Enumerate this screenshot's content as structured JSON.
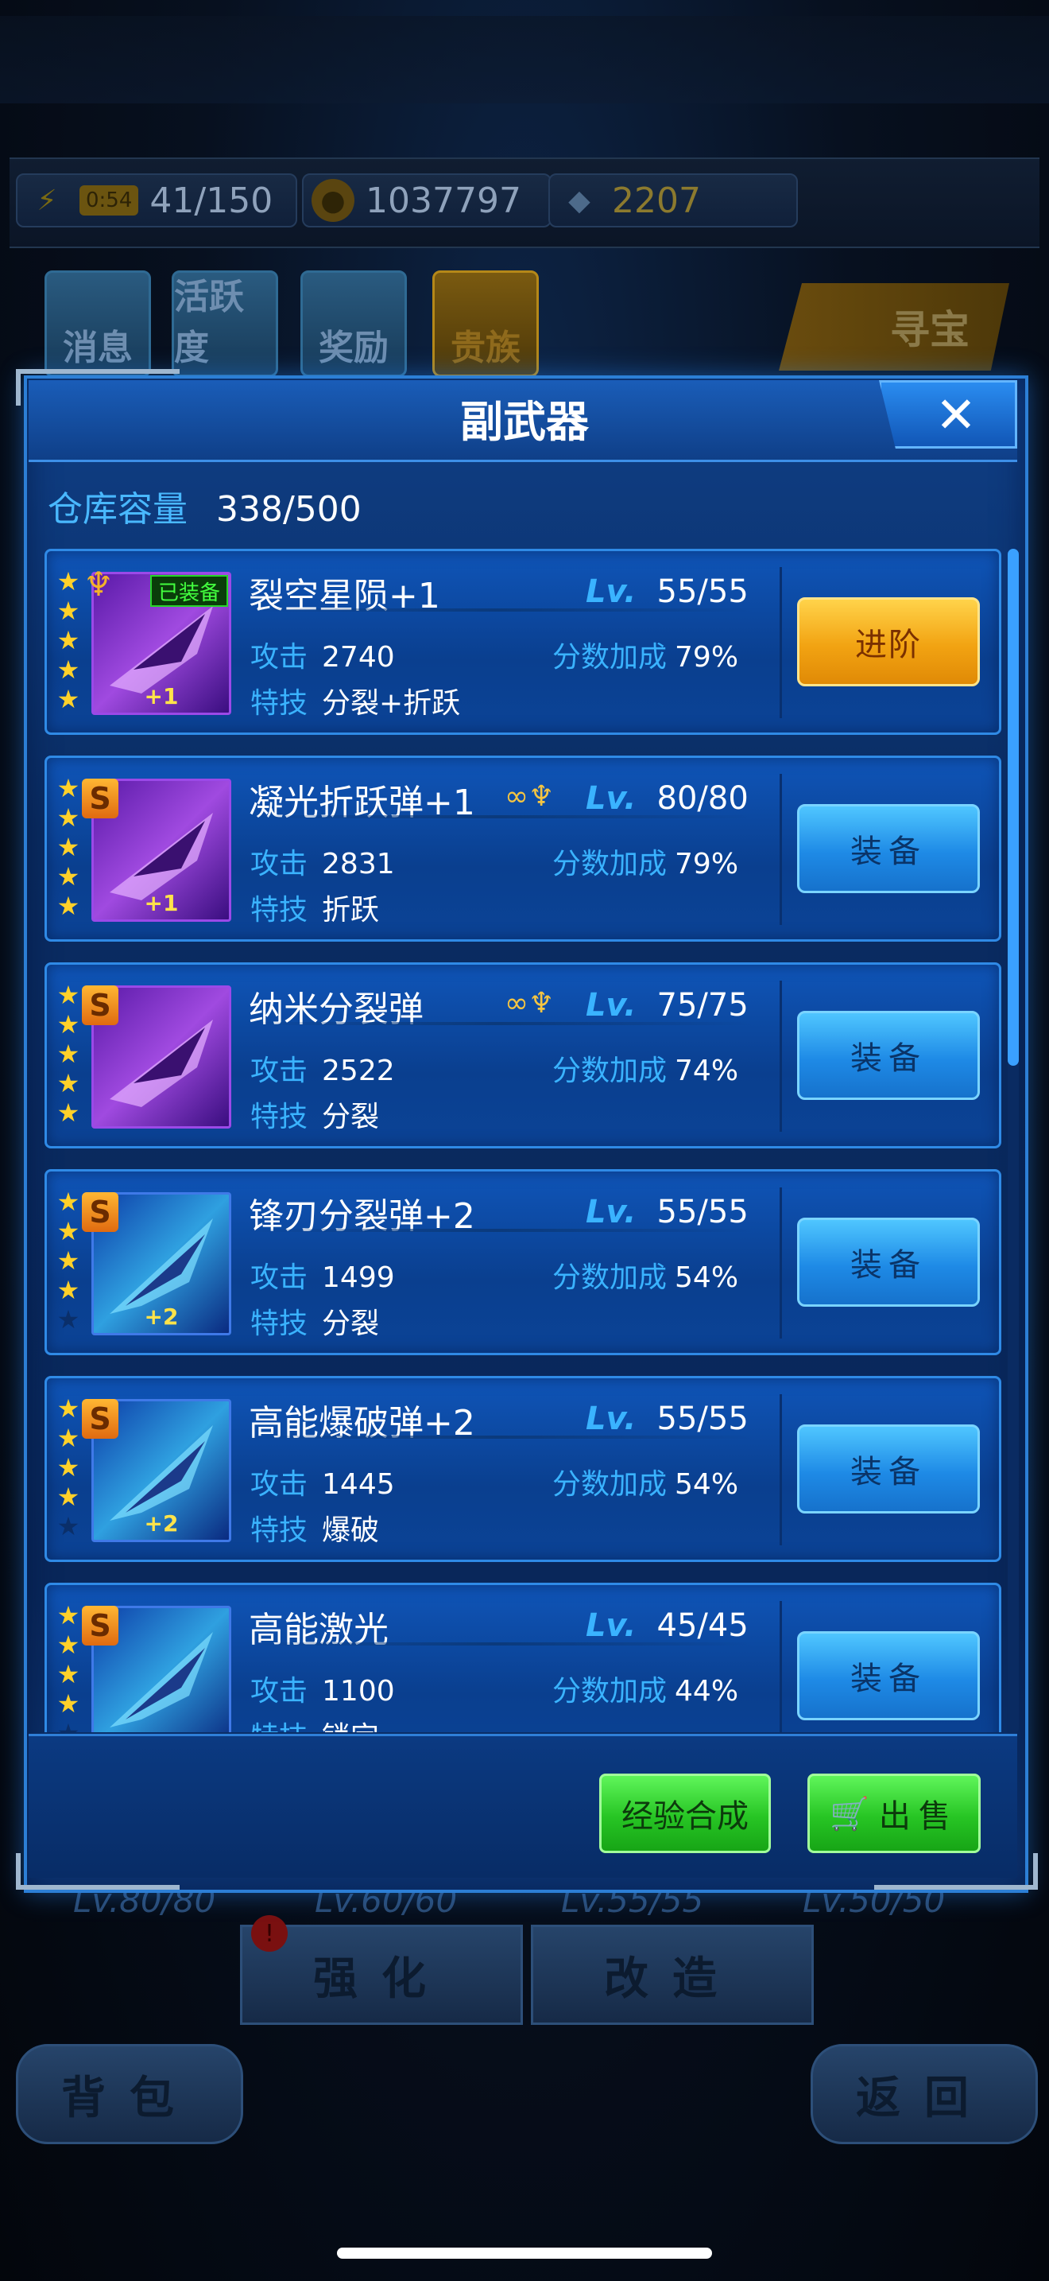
{
  "resources": {
    "energy_timer": "0:54",
    "energy": "41/150",
    "coins": "1037797",
    "gems": "2207"
  },
  "top_icons": [
    "消息",
    "活跃度",
    "奖励",
    "贵族"
  ],
  "treasure_label": "寻宝",
  "modal": {
    "title": "副武器",
    "close_symbol": "✕",
    "capacity_label": "仓库容量",
    "capacity_value": "338/500"
  },
  "labels": {
    "lv": "Lv.",
    "attack": "攻击",
    "skill": "特技",
    "bonus": "分数加成"
  },
  "weapons": [
    {
      "name": "裂空星陨+1",
      "level": "55/55",
      "attack": "2740",
      "bonus": "79%",
      "skill": "分裂+折跃",
      "stars": 5,
      "plus": "+1",
      "badge": "已装备",
      "rank": "wing",
      "set_icon": false,
      "action": "进阶",
      "action_type": "advance",
      "thumb": "purple"
    },
    {
      "name": "凝光折跃弹+1",
      "level": "80/80",
      "attack": "2831",
      "bonus": "79%",
      "skill": "折跃",
      "stars": 5,
      "plus": "+1",
      "badge": "",
      "rank": "S",
      "set_icon": true,
      "action": "装备",
      "action_type": "equip",
      "thumb": "purple"
    },
    {
      "name": "纳米分裂弹",
      "level": "75/75",
      "attack": "2522",
      "bonus": "74%",
      "skill": "分裂",
      "stars": 5,
      "plus": "",
      "badge": "",
      "rank": "S",
      "set_icon": true,
      "action": "装备",
      "action_type": "equip",
      "thumb": "purple"
    },
    {
      "name": "锋刃分裂弹+2",
      "level": "55/55",
      "attack": "1499",
      "bonus": "54%",
      "skill": "分裂",
      "stars": 4,
      "plus": "+2",
      "badge": "",
      "rank": "S",
      "set_icon": false,
      "action": "装备",
      "action_type": "equip",
      "thumb": "blue"
    },
    {
      "name": "高能爆破弹+2",
      "level": "55/55",
      "attack": "1445",
      "bonus": "54%",
      "skill": "爆破",
      "stars": 4,
      "plus": "+2",
      "badge": "",
      "rank": "S",
      "set_icon": false,
      "action": "装备",
      "action_type": "equip",
      "thumb": "blue"
    },
    {
      "name": "高能激光",
      "level": "45/45",
      "attack": "1100",
      "bonus": "44%",
      "skill": "锁定",
      "stars": 4,
      "plus": "",
      "badge": "",
      "rank": "S",
      "set_icon": false,
      "action": "装备",
      "action_type": "equip",
      "thumb": "blue"
    }
  ],
  "footer": {
    "exp_merge": "经验合成",
    "sell": "出售"
  },
  "background_bottom": {
    "levels": [
      "Lv.80/80",
      "Lv.60/60",
      "Lv.55/55",
      "Lv.50/50"
    ],
    "enhance": "强化",
    "modify": "改造",
    "backpack": "背包",
    "back": "返回",
    "alert": "!"
  }
}
